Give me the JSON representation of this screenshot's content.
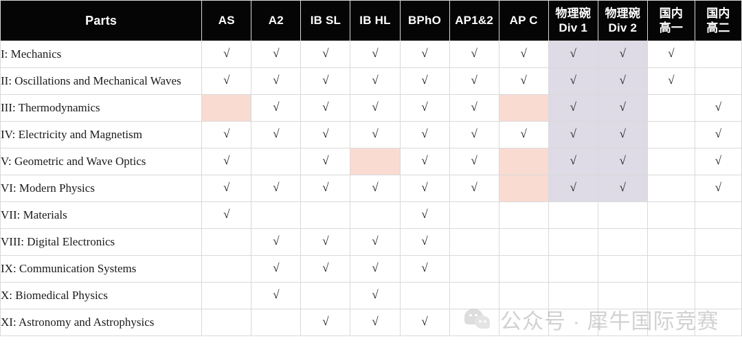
{
  "table": {
    "columns": [
      {
        "key": "parts",
        "label": "Parts",
        "label_line2": ""
      },
      {
        "key": "as",
        "label": "AS",
        "label_line2": ""
      },
      {
        "key": "a2",
        "label": "A2",
        "label_line2": ""
      },
      {
        "key": "ibsl",
        "label": "IB SL",
        "label_line2": ""
      },
      {
        "key": "ibhl",
        "label": "IB HL",
        "label_line2": ""
      },
      {
        "key": "bpho",
        "label": "BPhO",
        "label_line2": ""
      },
      {
        "key": "ap12",
        "label": "AP1&2",
        "label_line2": ""
      },
      {
        "key": "apc",
        "label": "AP C",
        "label_line2": ""
      },
      {
        "key": "pbdiv1",
        "label": "物理碗",
        "label_line2": "Div 1"
      },
      {
        "key": "pbdiv2",
        "label": "物理碗",
        "label_line2": "Div 2"
      },
      {
        "key": "gy1",
        "label": "国内",
        "label_line2": "高一"
      },
      {
        "key": "gy2",
        "label": "国内",
        "label_line2": "高二"
      }
    ],
    "tick_glyph": "√",
    "colors": {
      "header_bg": "#050505",
      "header_text": "#ffffff",
      "grid_line": "#d9d9d9",
      "highlight_pink": "#f9dbd2",
      "highlight_lavender": "#dedae6",
      "body_text": "#1a1a1a"
    },
    "rows": [
      {
        "label": "I: Mechanics",
        "cells": [
          {
            "mark": "√",
            "fill": ""
          },
          {
            "mark": "√",
            "fill": ""
          },
          {
            "mark": "√",
            "fill": ""
          },
          {
            "mark": "√",
            "fill": ""
          },
          {
            "mark": "√",
            "fill": ""
          },
          {
            "mark": "√",
            "fill": ""
          },
          {
            "mark": "√",
            "fill": ""
          },
          {
            "mark": "√",
            "fill": "lavender"
          },
          {
            "mark": "√",
            "fill": "lavender"
          },
          {
            "mark": "√",
            "fill": ""
          },
          {
            "mark": "",
            "fill": ""
          }
        ]
      },
      {
        "label": "II: Oscillations and Mechanical Waves",
        "cells": [
          {
            "mark": "√",
            "fill": ""
          },
          {
            "mark": "√",
            "fill": ""
          },
          {
            "mark": "√",
            "fill": ""
          },
          {
            "mark": "√",
            "fill": ""
          },
          {
            "mark": "√",
            "fill": ""
          },
          {
            "mark": "√",
            "fill": ""
          },
          {
            "mark": "√",
            "fill": ""
          },
          {
            "mark": "√",
            "fill": "lavender"
          },
          {
            "mark": "√",
            "fill": "lavender"
          },
          {
            "mark": "√",
            "fill": ""
          },
          {
            "mark": "",
            "fill": ""
          }
        ]
      },
      {
        "label": "III: Thermodynamics",
        "cells": [
          {
            "mark": "",
            "fill": "pink"
          },
          {
            "mark": "√",
            "fill": ""
          },
          {
            "mark": "√",
            "fill": ""
          },
          {
            "mark": "√",
            "fill": ""
          },
          {
            "mark": "√",
            "fill": ""
          },
          {
            "mark": "√",
            "fill": ""
          },
          {
            "mark": "",
            "fill": "pink"
          },
          {
            "mark": "√",
            "fill": "lavender"
          },
          {
            "mark": "√",
            "fill": "lavender"
          },
          {
            "mark": "",
            "fill": ""
          },
          {
            "mark": "√",
            "fill": ""
          }
        ]
      },
      {
        "label": "IV: Electricity and Magnetism",
        "cells": [
          {
            "mark": "√",
            "fill": ""
          },
          {
            "mark": "√",
            "fill": ""
          },
          {
            "mark": "√",
            "fill": ""
          },
          {
            "mark": "√",
            "fill": ""
          },
          {
            "mark": "√",
            "fill": ""
          },
          {
            "mark": "√",
            "fill": ""
          },
          {
            "mark": "√",
            "fill": ""
          },
          {
            "mark": "√",
            "fill": "lavender"
          },
          {
            "mark": "√",
            "fill": "lavender"
          },
          {
            "mark": "",
            "fill": ""
          },
          {
            "mark": "√",
            "fill": ""
          }
        ]
      },
      {
        "label": "V: Geometric and Wave Optics",
        "cells": [
          {
            "mark": "√",
            "fill": ""
          },
          {
            "mark": "",
            "fill": ""
          },
          {
            "mark": "√",
            "fill": ""
          },
          {
            "mark": "",
            "fill": "pink"
          },
          {
            "mark": "√",
            "fill": ""
          },
          {
            "mark": "√",
            "fill": ""
          },
          {
            "mark": "",
            "fill": "pink"
          },
          {
            "mark": "√",
            "fill": "lavender"
          },
          {
            "mark": "√",
            "fill": "lavender"
          },
          {
            "mark": "",
            "fill": ""
          },
          {
            "mark": "√",
            "fill": ""
          }
        ]
      },
      {
        "label": "VI: Modern Physics",
        "cells": [
          {
            "mark": "√",
            "fill": ""
          },
          {
            "mark": "√",
            "fill": ""
          },
          {
            "mark": "√",
            "fill": ""
          },
          {
            "mark": "√",
            "fill": ""
          },
          {
            "mark": "√",
            "fill": ""
          },
          {
            "mark": "√",
            "fill": ""
          },
          {
            "mark": "",
            "fill": "pink"
          },
          {
            "mark": "√",
            "fill": "lavender"
          },
          {
            "mark": "√",
            "fill": "lavender"
          },
          {
            "mark": "",
            "fill": ""
          },
          {
            "mark": "√",
            "fill": ""
          }
        ]
      },
      {
        "label": "VII: Materials",
        "cells": [
          {
            "mark": "√",
            "fill": ""
          },
          {
            "mark": "",
            "fill": ""
          },
          {
            "mark": "",
            "fill": ""
          },
          {
            "mark": "",
            "fill": ""
          },
          {
            "mark": "√",
            "fill": ""
          },
          {
            "mark": "",
            "fill": ""
          },
          {
            "mark": "",
            "fill": ""
          },
          {
            "mark": "",
            "fill": ""
          },
          {
            "mark": "",
            "fill": ""
          },
          {
            "mark": "",
            "fill": ""
          },
          {
            "mark": "",
            "fill": ""
          }
        ]
      },
      {
        "label": "VIII: Digital Electronics",
        "cells": [
          {
            "mark": "",
            "fill": ""
          },
          {
            "mark": "√",
            "fill": ""
          },
          {
            "mark": "√",
            "fill": ""
          },
          {
            "mark": "√",
            "fill": ""
          },
          {
            "mark": "√",
            "fill": ""
          },
          {
            "mark": "",
            "fill": ""
          },
          {
            "mark": "",
            "fill": ""
          },
          {
            "mark": "",
            "fill": ""
          },
          {
            "mark": "",
            "fill": ""
          },
          {
            "mark": "",
            "fill": ""
          },
          {
            "mark": "",
            "fill": ""
          }
        ]
      },
      {
        "label": "IX: Communication Systems",
        "cells": [
          {
            "mark": "",
            "fill": ""
          },
          {
            "mark": "√",
            "fill": ""
          },
          {
            "mark": "√",
            "fill": ""
          },
          {
            "mark": "√",
            "fill": ""
          },
          {
            "mark": "√",
            "fill": ""
          },
          {
            "mark": "",
            "fill": ""
          },
          {
            "mark": "",
            "fill": ""
          },
          {
            "mark": "",
            "fill": ""
          },
          {
            "mark": "",
            "fill": ""
          },
          {
            "mark": "",
            "fill": ""
          },
          {
            "mark": "",
            "fill": ""
          }
        ]
      },
      {
        "label": "X: Biomedical Physics",
        "cells": [
          {
            "mark": "",
            "fill": ""
          },
          {
            "mark": "√",
            "fill": ""
          },
          {
            "mark": "",
            "fill": ""
          },
          {
            "mark": "√",
            "fill": ""
          },
          {
            "mark": "",
            "fill": ""
          },
          {
            "mark": "",
            "fill": ""
          },
          {
            "mark": "",
            "fill": ""
          },
          {
            "mark": "",
            "fill": ""
          },
          {
            "mark": "",
            "fill": ""
          },
          {
            "mark": "",
            "fill": ""
          },
          {
            "mark": "",
            "fill": ""
          }
        ]
      },
      {
        "label": "XI: Astronomy and Astrophysics",
        "cells": [
          {
            "mark": "",
            "fill": ""
          },
          {
            "mark": "",
            "fill": ""
          },
          {
            "mark": "√",
            "fill": ""
          },
          {
            "mark": "√",
            "fill": ""
          },
          {
            "mark": "√",
            "fill": ""
          },
          {
            "mark": "",
            "fill": ""
          },
          {
            "mark": "",
            "fill": ""
          },
          {
            "mark": "",
            "fill": ""
          },
          {
            "mark": "",
            "fill": ""
          },
          {
            "mark": "",
            "fill": ""
          },
          {
            "mark": "",
            "fill": ""
          }
        ]
      }
    ]
  },
  "watermark": {
    "text": "公众号 · 犀牛国际竞赛",
    "icon": "wechat-icon"
  }
}
